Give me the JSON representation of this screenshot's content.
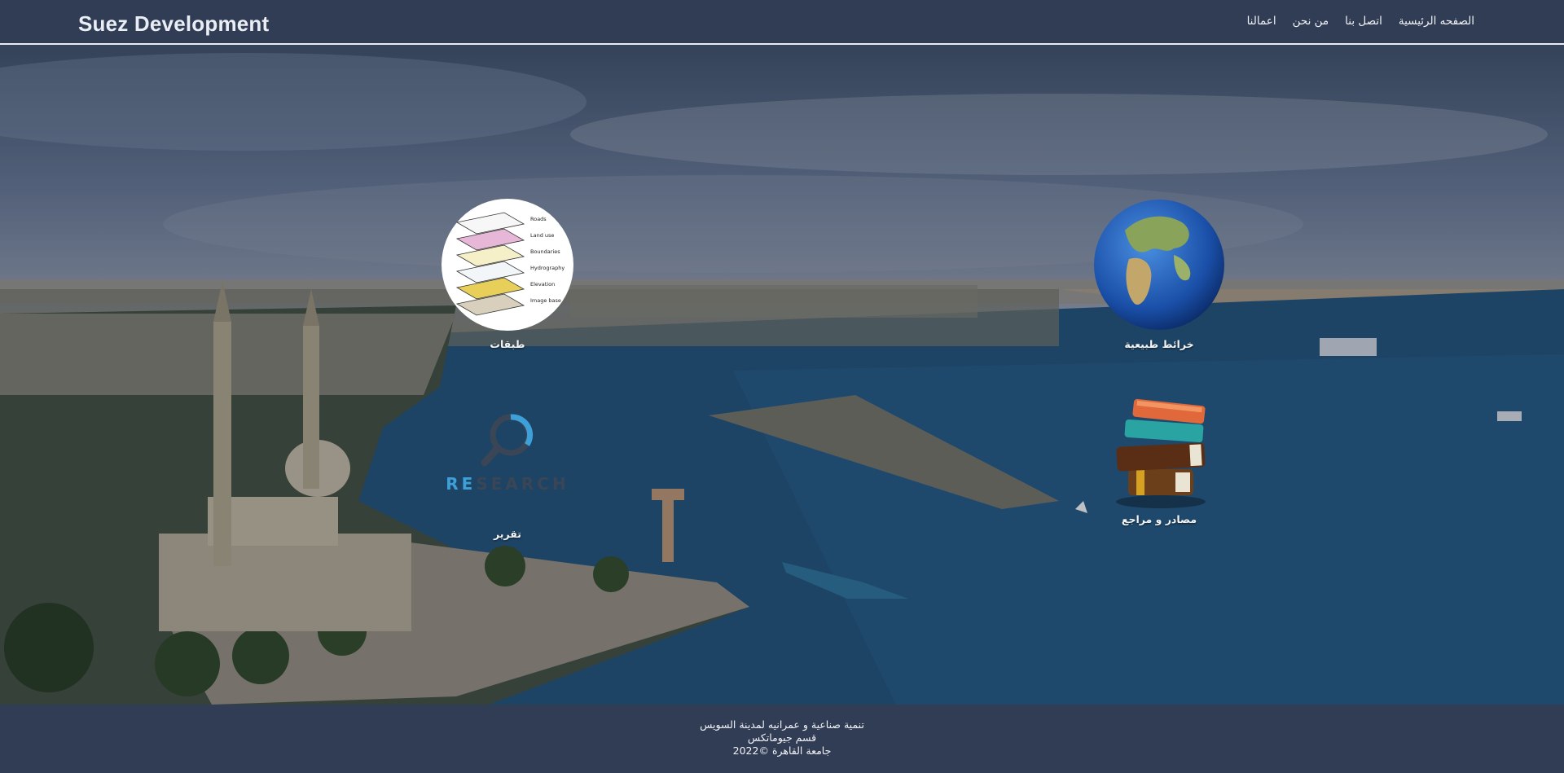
{
  "navbar": {
    "brand": "Suez Development",
    "links": [
      "الصفحه الرئيسية",
      "اتصل بنا",
      "من نحن",
      "اعمالنا"
    ]
  },
  "tiles": {
    "layers": {
      "caption": "طبقات",
      "legend": [
        "Roads",
        "Land use",
        "Boundaries",
        "Hydrography",
        "Elevation",
        "Image base"
      ]
    },
    "maps": {
      "caption": "خرائط طبيعية"
    },
    "report": {
      "caption": "تقرير",
      "re": "RE",
      "rest": "SEARCH"
    },
    "sources": {
      "caption": "مصادر و مراجع"
    }
  },
  "footer": {
    "line1": "تنمية صناعية و عمرانيه لمدينة السويس",
    "line2": "قسم جيوماتكس",
    "line3": "جامعة القاهرة ©2022"
  },
  "colors": {
    "nav_bg": "#313c55",
    "footer_bg": "#313c55",
    "accent": "#3ea0d8"
  }
}
